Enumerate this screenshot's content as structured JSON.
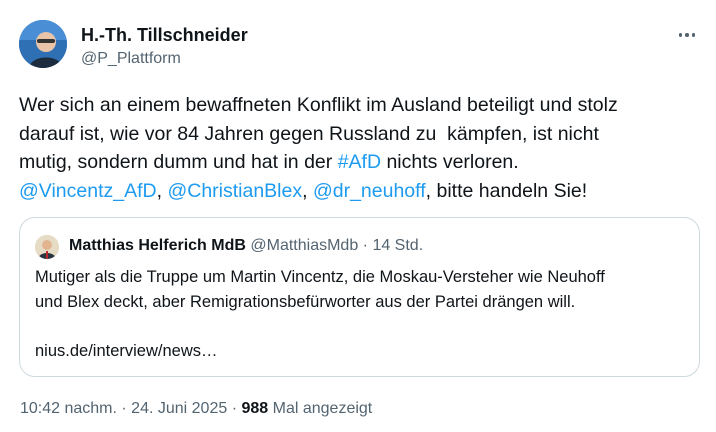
{
  "author": {
    "name": "H.-Th. Tillschneider",
    "handle": "@P_Plattform"
  },
  "tweet": {
    "line1": "Wer sich an einem bewaffneten Konflikt im Ausland beteiligt und stolz",
    "line2": "darauf ist, wie vor 84 Jahren gegen Russland zu  kämpfen, ist nicht",
    "line3_a": "mutig, sondern dumm und hat in der ",
    "hashtag": "#AfD",
    "line3_b": " nichts verloren.",
    "mention1": "@Vincentz_AfD",
    "sep1": ", ",
    "mention2": "@ChristianBlex",
    "sep2": ", ",
    "mention3": "@dr_neuhoff",
    "line4_end": ", bitte handeln Sie!"
  },
  "quote": {
    "name": "Matthias Helferich MdB",
    "handle": "@MatthiasMdb",
    "separator": " · ",
    "time": "14 Std.",
    "text": "Mutiger als die Truppe um Martin Vincentz, die Moskau-Versteher wie Neuhoff\nund Blex deckt, aber Remigrationsbefürworter aus der Partei drängen will.\n\nnius.de/interview/news…"
  },
  "footer": {
    "time": "10:42 nachm.",
    "dot1": " · ",
    "date": "24. Juni 2025",
    "dot2": " · ",
    "views": "988",
    "views_label": " Mal angezeigt"
  },
  "icons": {
    "more": "more-horizontal-icon"
  },
  "colors": {
    "link": "#1d9bf0",
    "secondary_text": "#536471",
    "primary_text": "#0f1419",
    "border": "#cfd9de"
  }
}
